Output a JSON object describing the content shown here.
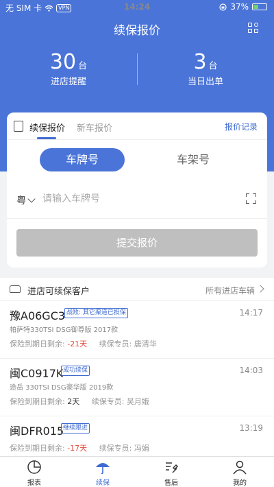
{
  "status": {
    "carrier": "无 SIM 卡",
    "vpn": "VPN",
    "time": "14:24",
    "battery": "37%",
    "battery_level": 0.37
  },
  "header": {
    "title": "续保报价"
  },
  "stats": [
    {
      "value": "30",
      "unit": "台",
      "label": "进店提醒"
    },
    {
      "value": "3",
      "unit": "台",
      "label": "当日出单"
    }
  ],
  "quote_card": {
    "tab_active": "续保报价",
    "tab_other": "新车报价",
    "log_link": "报价记录",
    "segment_active": "车牌号",
    "segment_other": "车架号",
    "province": "粤",
    "plate_placeholder": "请输入车牌号",
    "submit_label": "提交报价"
  },
  "customers": {
    "title": "进店可续保客户",
    "all_link": "所有进店车辆",
    "expire_label": "保险到期日剩余:",
    "specialist_label": "续保专员:",
    "items": [
      {
        "plate": "豫A06GC3",
        "badge": "战败: 其它渠道已投保",
        "time": "14:17",
        "model": "帕萨特330TSI DSG御尊版 2017款",
        "days": "-21天",
        "specialist": "唐清华"
      },
      {
        "plate": "闽C0917K",
        "badge": "成功续保",
        "time": "14:03",
        "model": "途岳 330TSI DSG豪华版 2019款",
        "days": "2天",
        "specialist": "吴月娥"
      },
      {
        "plate": "闽DFR015",
        "badge": "继续跟进",
        "time": "13:19",
        "model": "",
        "days": "-17天",
        "specialist": "冯娟"
      }
    ]
  },
  "nav": [
    {
      "label": "报表",
      "icon": "report-icon"
    },
    {
      "label": "续保",
      "icon": "umbrella-icon"
    },
    {
      "label": "售后",
      "icon": "service-icon"
    },
    {
      "label": "我的",
      "icon": "user-icon"
    }
  ],
  "colors": {
    "primary": "#4a74d8",
    "negative": "#e24a3a"
  }
}
